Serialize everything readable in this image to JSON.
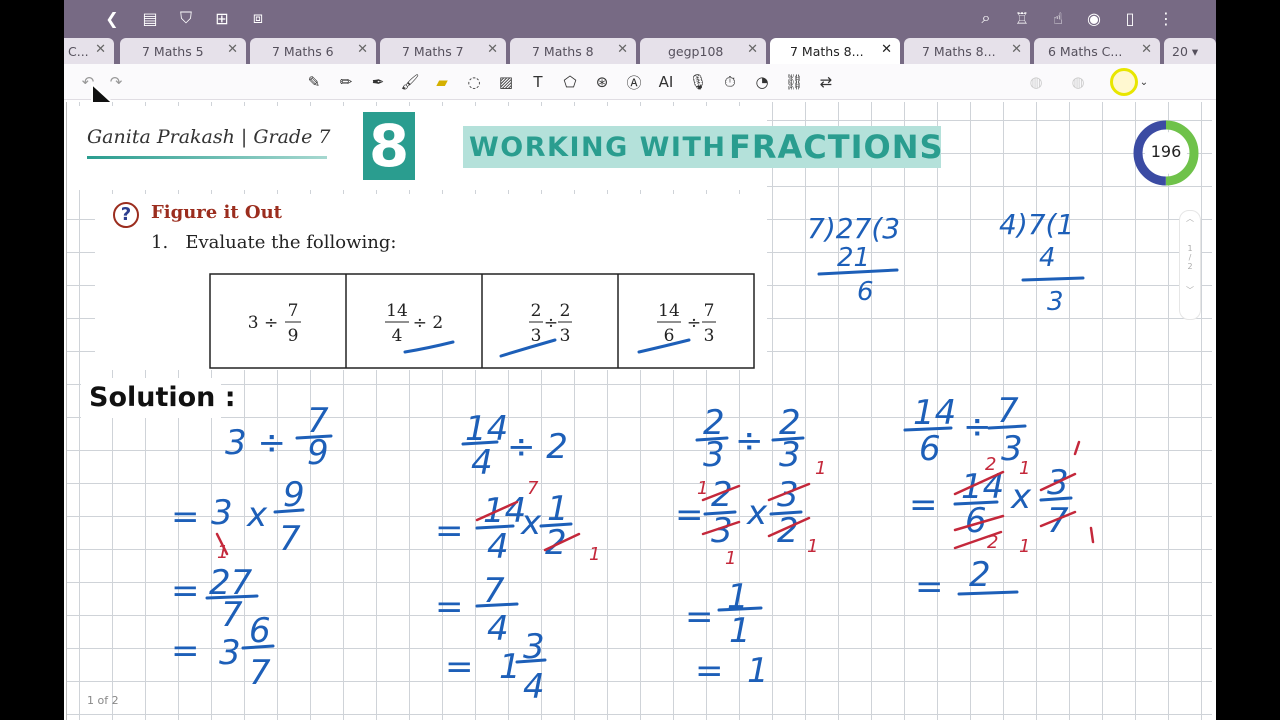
{
  "tabs": [
    {
      "label": "C..."
    },
    {
      "label": "7 Maths 5"
    },
    {
      "label": "7 Maths 6"
    },
    {
      "label": "7 Maths 7"
    },
    {
      "label": "7 Maths 8"
    },
    {
      "label": "gegp108"
    },
    {
      "label": "7 Maths 8..."
    },
    {
      "label": "7 Maths 8..."
    },
    {
      "label": "6 Maths C..."
    },
    {
      "label": "20 ▾"
    }
  ],
  "book": {
    "title": "Ganita Prakash | Grade 7",
    "chapter_number": "8",
    "chapter_title_a": "WORKING WITH",
    "chapter_title_b": "FRACTIONS",
    "page_counter": "196",
    "section_title": "Figure it Out",
    "question": "1.   Evaluate the following:",
    "solution_label": "Solution :"
  },
  "page_indicator": "1 of 2",
  "side_scroll": {
    "top": "1",
    "sep": "/",
    "bottom": "2"
  },
  "colors": {
    "topbar": "#776a84",
    "pen": "#1d5fb8",
    "red_pen": "#c4283b",
    "accent_green": "#2a9d8f"
  },
  "icons": [
    "back-icon",
    "reader-icon",
    "bookmark-icon",
    "add-page-icon",
    "crop-icon",
    "search-icon",
    "shirt-icon",
    "touch-icon",
    "eye-icon",
    "document-icon",
    "more-icon"
  ]
}
